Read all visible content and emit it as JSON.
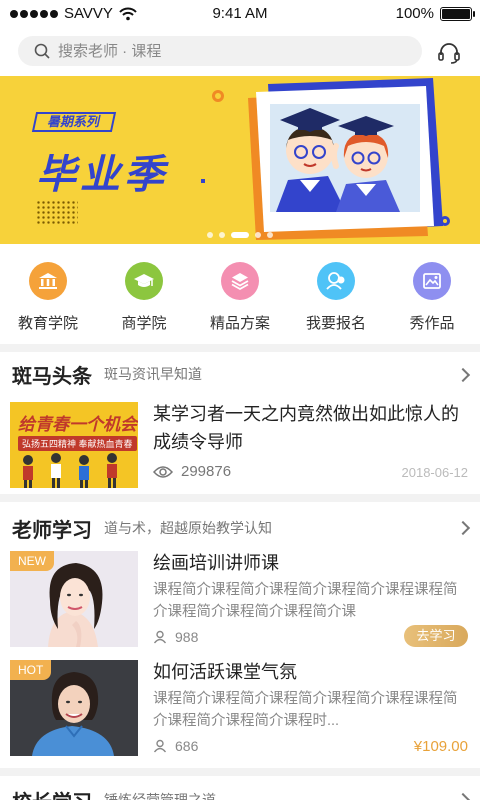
{
  "status_bar": {
    "carrier": "SAVVY",
    "time": "9:41 AM",
    "battery": "100%"
  },
  "search": {
    "placeholder": "搜索老师 · 课程"
  },
  "banner": {
    "tag": "暑期系列",
    "title": "毕业季",
    "pages": 5,
    "active_page": 3
  },
  "quick_menu": [
    {
      "label": "教育学院",
      "icon": "building-icon",
      "color": "#f5a23a"
    },
    {
      "label": "商学院",
      "icon": "graduation-cap-icon",
      "color": "#8cc63f"
    },
    {
      "label": "精品方案",
      "icon": "layers-icon",
      "color": "#f48fb1"
    },
    {
      "label": "我要报名",
      "icon": "chat-users-icon",
      "color": "#4fc3f7"
    },
    {
      "label": "秀作品",
      "icon": "picture-icon",
      "color": "#8e8ff0"
    }
  ],
  "news": {
    "title": "斑马头条",
    "subtitle": "斑马资讯早知道",
    "item": {
      "thumb_title": "给青春一个机会",
      "thumb_sub": "弘扬五四精神 奉献热血青春",
      "title": "某学习者一天之内竟然做出如此惊人的成绩令导师",
      "views": "299876",
      "date": "2018-06-12"
    }
  },
  "teacher": {
    "title": "老师学习",
    "subtitle": "道与术，超越原始教学认知",
    "courses": [
      {
        "badge": "NEW",
        "title": "绘画培训讲师课",
        "desc": "课程简介课程简介课程简介课程简介课程课程简介课程简介课程简介课程简介课",
        "students": "988",
        "action": "去学习"
      },
      {
        "badge": "HOT",
        "title": "如何活跃课堂气氛",
        "desc": "课程简介课程简介课程简介课程简介课程课程简介课程简介课程简介课程时...",
        "students": "686",
        "price": "¥109.00"
      }
    ]
  },
  "principal": {
    "title": "校长学习",
    "subtitle": "锤炼经营管理之道"
  }
}
